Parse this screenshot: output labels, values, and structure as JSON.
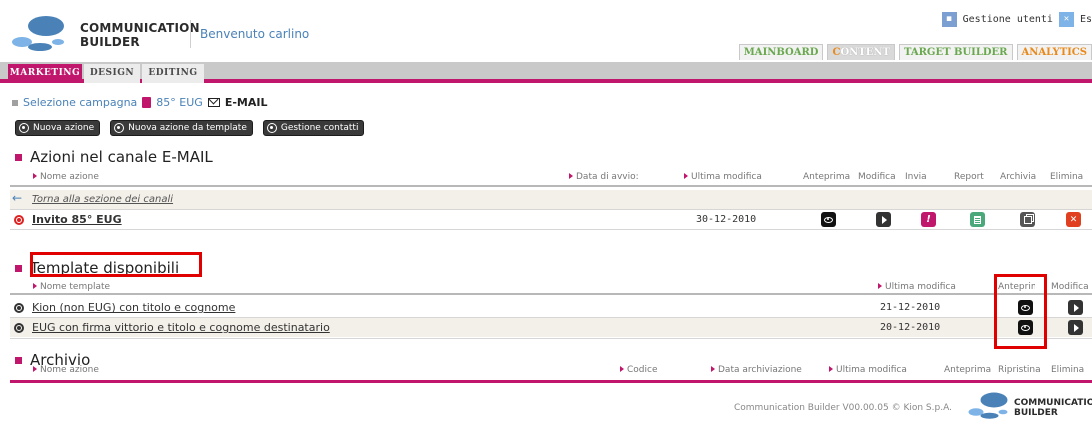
{
  "header": {
    "brand_line1": "COMMUNICATION",
    "brand_line2": "BUILDER",
    "welcome": "Benvenuto carlino",
    "user_mgmt": "Gestione utenti",
    "exit": "Es",
    "main_tabs": [
      {
        "label": "MAINBOARD",
        "active": false
      },
      {
        "label": "CONTENT",
        "active": true
      },
      {
        "label": "TARGET BUILDER",
        "active": false
      },
      {
        "label": "ANALYTICS",
        "active": false
      }
    ],
    "colors": {
      "accent": "#c0166c",
      "blue": "#4a82b8",
      "content_o": "#e8891a",
      "green": "#6aa84f"
    }
  },
  "subnav": {
    "tabs": [
      {
        "label": "MARKETING",
        "active": true
      },
      {
        "label": "DESIGN",
        "active": false
      },
      {
        "label": "EDITING",
        "active": false
      }
    ]
  },
  "breadcrumb": {
    "root": "Selezione campagna",
    "campaign": "85° EUG",
    "channel": "E-MAIL"
  },
  "actions": {
    "new_action": "Nuova azione",
    "new_from_template": "Nuova azione da template",
    "contacts": "Gestione contatti"
  },
  "azioni": {
    "title": "Azioni nel canale E-MAIL",
    "cols": {
      "name": "Nome azione",
      "start": "Data di avvio:",
      "modified": "Ultima modifica",
      "preview": "Anteprima",
      "edit": "Modifica",
      "send": "Invia",
      "report": "Report",
      "archive": "Archivia",
      "delete": "Elimina"
    },
    "back_link": "Torna alla sezione dei canali",
    "rows": [
      {
        "name": "Invito 85° EUG",
        "modified": "30-12-2010"
      }
    ]
  },
  "templates": {
    "title": "Template disponibili",
    "cols": {
      "name": "Nome template",
      "modified": "Ultima modifica",
      "preview": "Anteprima",
      "edit": "Modifica"
    },
    "rows": [
      {
        "name": "Kion (non EUG) con titolo e cognome",
        "modified": "21-12-2010"
      },
      {
        "name": "EUG con firma vittorio e titolo e cognome destinatario",
        "modified": "20-12-2010"
      }
    ]
  },
  "archivio": {
    "title": "Archivio",
    "cols": {
      "name": "Nome azione",
      "code": "Codice",
      "archived": "Data archiviazione",
      "modified": "Ultima modifica",
      "preview": "Anteprima",
      "restore": "Ripristina",
      "delete": "Elimina"
    }
  },
  "footer": {
    "text": "Communication Builder V00.00.05 © Kion S.p.A.",
    "brand_line1": "COMMUNICATION",
    "brand_line2": "BUILDER"
  }
}
